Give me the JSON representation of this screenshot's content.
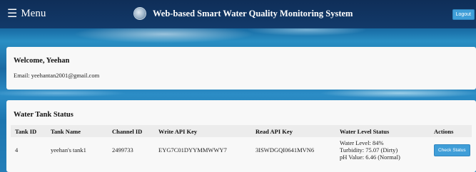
{
  "header": {
    "menu_label": "Menu",
    "menu_icon": "☰",
    "title": "Web-based Smart Water Quality Monitoring System",
    "logout_label": "Logout"
  },
  "welcome": {
    "title": "Welcome, Yeehan",
    "email": "Email: yeehantan2001@gmail.com"
  },
  "tank_status": {
    "title": "Water Tank Status",
    "columns": [
      "Tank ID",
      "Tank Name",
      "Channel ID",
      "Write API Key",
      "Read API Key",
      "Water Level Status",
      "Actions"
    ],
    "rows": [
      {
        "tank_id": "4",
        "tank_name": "yeehan's tank1",
        "channel_id": "2499733",
        "write_api_key": "EYG7C01DYYMMWWY7",
        "read_api_key": "3ISWDGQI0641MVN6",
        "water_level": "Water Level: 84%",
        "turbidity": "Turbidity: 75.07 (Dirty)",
        "ph": "pH Value: 6.46 (Normal)",
        "action_label": "Check Status"
      }
    ]
  },
  "colors": {
    "header_bg": "#123a6a",
    "button_bg": "#3f9ed8",
    "card_bg": "#f8f8f8"
  },
  "icons": {
    "menu": "hamburger-icon",
    "logo": "globe-icon"
  }
}
